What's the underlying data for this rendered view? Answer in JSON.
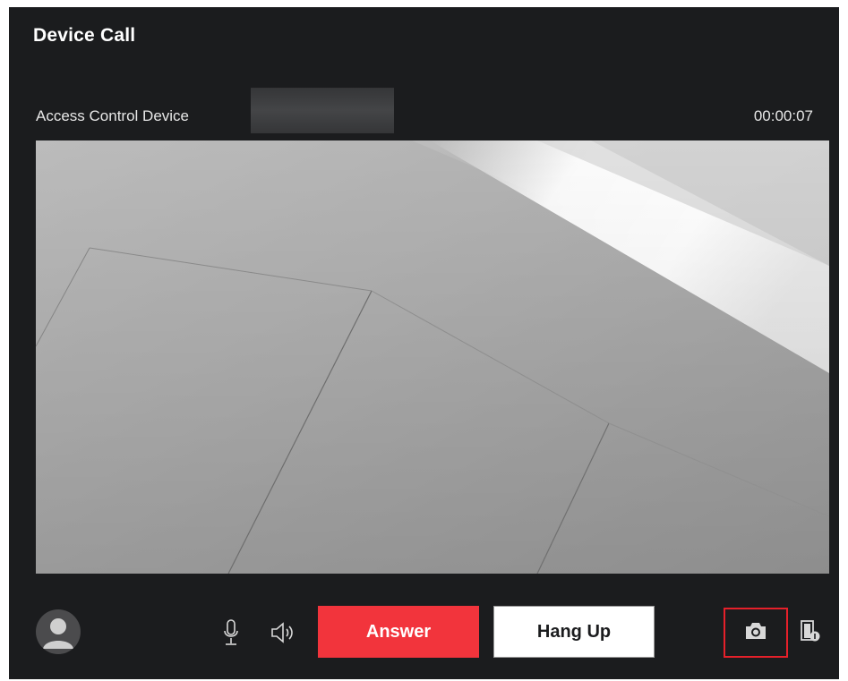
{
  "window": {
    "title": "Device Call"
  },
  "call": {
    "device_name": "Access Control Device",
    "elapsed": "00:00:07"
  },
  "controls": {
    "answer_label": "Answer",
    "hangup_label": "Hang Up"
  },
  "icons": {
    "avatar": "user-avatar-icon",
    "microphone": "microphone-icon",
    "speaker": "speaker-icon",
    "snapshot": "camera-icon",
    "device_info": "door-info-icon"
  },
  "colors": {
    "background": "#1b1c1e",
    "answer": "#f2343c",
    "highlight": "#e6202a",
    "hangup_bg": "#ffffff"
  }
}
